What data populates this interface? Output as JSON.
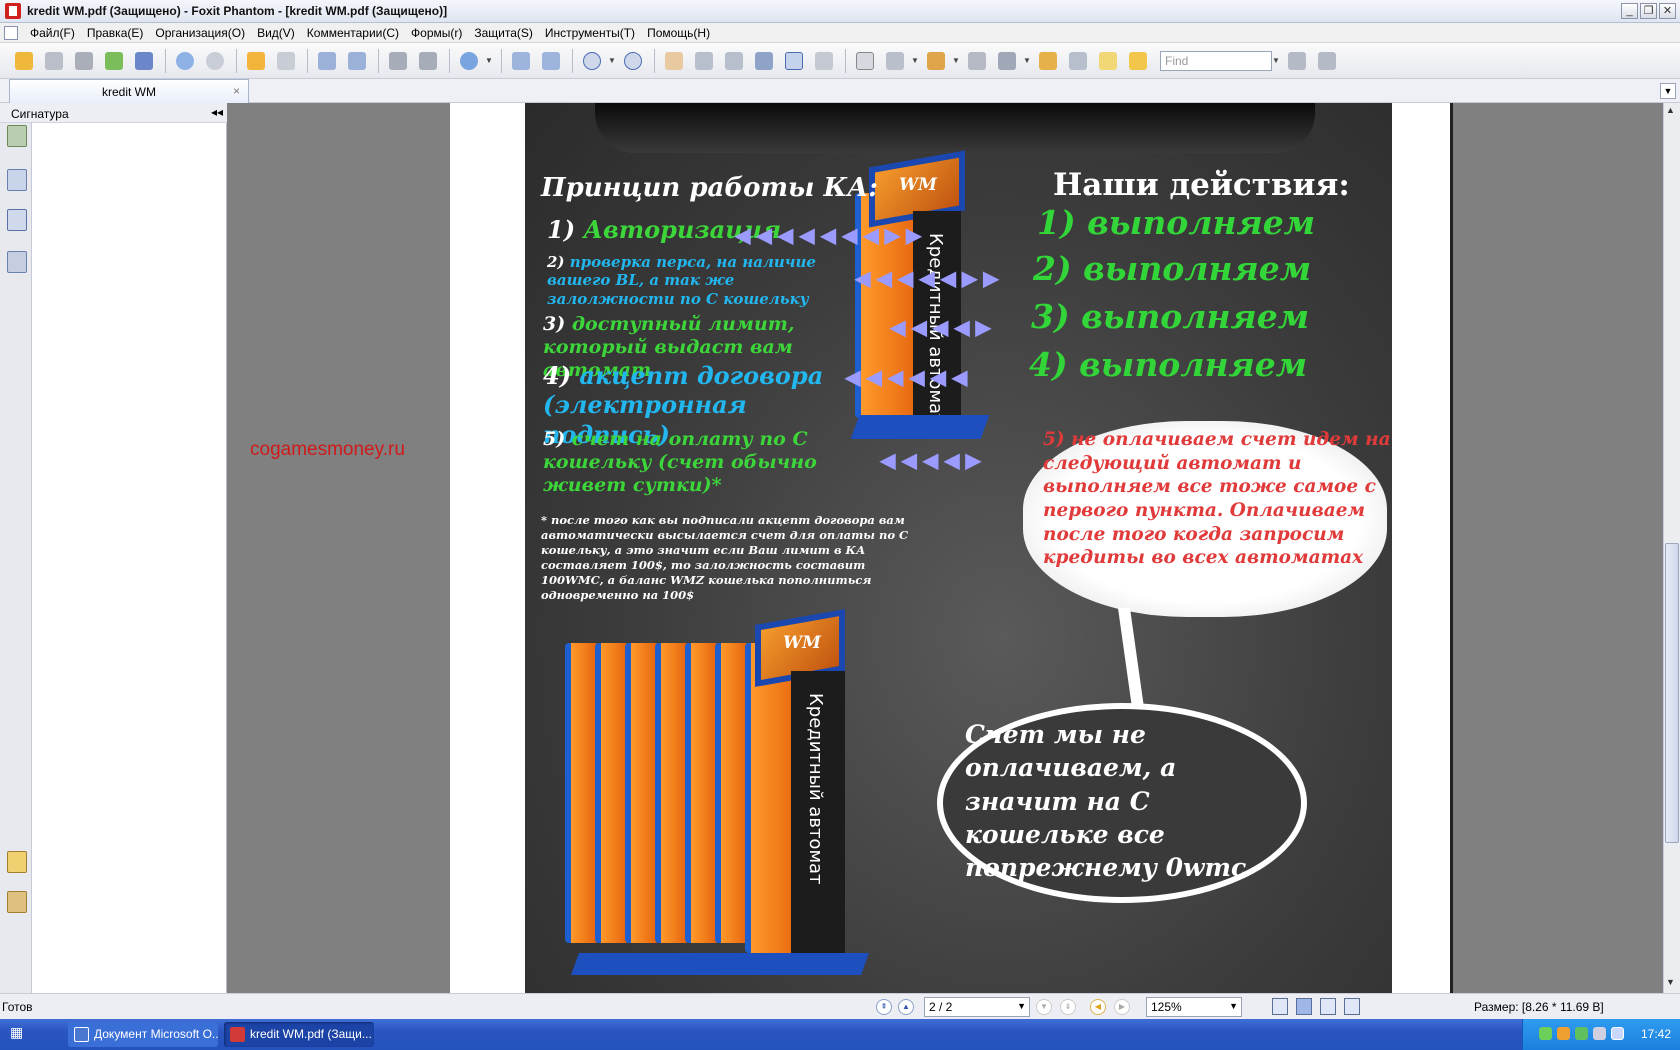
{
  "window": {
    "title": "kredit WM.pdf (Защищено) - Foxit Phantom - [kredit WM.pdf (Защищено)]",
    "controls": [
      "_",
      "❐",
      "✕"
    ]
  },
  "menu": [
    "Файл(F)",
    "Правка(E)",
    "Организация(O)",
    "Вид(V)",
    "Комментарии(C)",
    "Формы(r)",
    "Защита(S)",
    "Инструменты(T)",
    "Помощь(H)"
  ],
  "toolbar": {
    "find_placeholder": "Find",
    "icons": [
      "open-icon",
      "save-icon",
      "print-icon",
      "email-icon",
      "scan-icon",
      "prev-up-icon",
      "next-down-icon",
      "back-icon",
      "forward-icon",
      "extract-icon",
      "insert-icon",
      "undo-icon",
      "redo-icon",
      "zoom-in-icon",
      "page-fit-icon",
      "page-width-icon",
      "zoom-out-circle-icon",
      "zoom-in-circle-icon",
      "hand-icon",
      "select-text-icon",
      "select-icon",
      "snapshot-icon",
      "text-icon",
      "image-icon",
      "rect-icon",
      "pencil-icon",
      "stamp-icon",
      "eraser-icon",
      "lock-icon",
      "edit-icon",
      "form-icon",
      "typewriter-icon",
      "comment-icon",
      "find-prev-icon",
      "find-next-icon"
    ]
  },
  "tab": {
    "label": "kredit WM",
    "close": "×"
  },
  "sidebar": {
    "title": "Сигнатура",
    "collapse": "◂◂"
  },
  "watermark": "cogamesmoney.ru",
  "slide": {
    "left_heading": "Принцип работы КА:",
    "right_heading": "Наши действия:",
    "steps": [
      {
        "num": "1)",
        "text": "Авторизация"
      },
      {
        "num": "2)",
        "text": "проверка перса, на наличие вашего BL, а так же залолжности по С кошельку"
      },
      {
        "num": "3)",
        "text": "доступный лимит, который выдаст вам автомат"
      },
      {
        "num": "4)",
        "text": "акцепт договора (электронная подпись)"
      },
      {
        "num": "5)",
        "text": "счет на оплату по С кошельку (счет обычно живет сутки)*"
      }
    ],
    "actions": [
      "1) выполняем",
      "2) выполняем",
      "3) выполняем",
      "4) выполняем"
    ],
    "footnote": "* после того как вы подписали акцепт договора вам автоматически высылается счет для оплаты по С кошельку, а это значит если Ваш лимит в КА составляет 100$, то залолжность составит 100WMC, а баланс WMZ кошелька пополниться одновременно на 100$",
    "cloud_text": "5) не оплачиваем счет идем на следующий автомат и выполняем все тоже самое с первого пункта. Оплачиваем после того когда запросим кредиты во всех автоматах",
    "bubble_text": "Счет мы не оплачиваем, а значит на С кошельке все попрежнему 0wmc",
    "kiosk_label": "Кредитный автомат",
    "kiosk_logo": "WM"
  },
  "status": {
    "ready": "Готов",
    "page": "2 / 2",
    "zoom": "125%",
    "size": "Размер: [8.26 * 11.69 В]"
  },
  "taskbar": {
    "items": [
      "Документ Microsoft O...",
      "kredit WM.pdf (Защи..."
    ],
    "clock": "17:42"
  },
  "colors": {
    "green": "#3dd63a",
    "cyan": "#22b7ef",
    "red_text": "#e03a3a",
    "watermark": "#d01a1a"
  }
}
